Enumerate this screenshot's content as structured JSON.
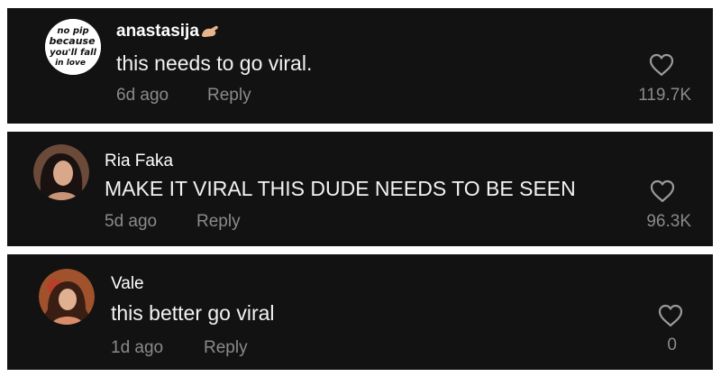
{
  "comments": [
    {
      "username": "anastasija",
      "username_emoji": "hand-icon",
      "avatar_text": [
        "no pip",
        "because",
        "you'll fall",
        "in love"
      ],
      "text": "this needs to go viral.",
      "age": "6d ago",
      "reply_label": "Reply",
      "likes": "119.7K"
    },
    {
      "username": "Ria Faka",
      "text": "MAKE IT VIRAL THIS DUDE NEEDS TO BE SEEN",
      "age": "5d ago",
      "reply_label": "Reply",
      "likes": "96.3K"
    },
    {
      "username": "Vale",
      "text": "this better go viral",
      "age": "1d ago",
      "reply_label": "Reply",
      "likes": "0"
    }
  ],
  "colors": {
    "card_bg": "#121212",
    "text_primary": "#ffffff",
    "text_secondary": "#8a8a8a",
    "heart_stroke": "#9a9a9a"
  }
}
